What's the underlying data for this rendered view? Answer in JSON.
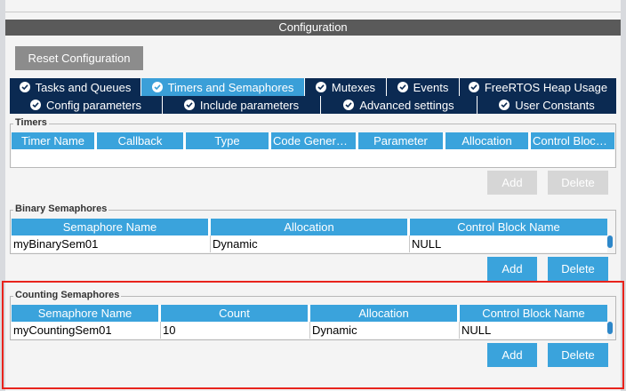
{
  "header": {
    "title": "Configuration"
  },
  "reset_label": "Reset Configuration",
  "tabs_row1": [
    {
      "label": "Tasks and Queues",
      "active": false
    },
    {
      "label": "Timers and Semaphores",
      "active": true
    },
    {
      "label": "Mutexes",
      "active": false
    },
    {
      "label": "Events",
      "active": false
    },
    {
      "label": "FreeRTOS Heap Usage",
      "active": false
    }
  ],
  "tabs_row2": [
    {
      "label": "Config parameters"
    },
    {
      "label": "Include parameters"
    },
    {
      "label": "Advanced settings"
    },
    {
      "label": "User Constants"
    }
  ],
  "timers": {
    "title": "Timers",
    "columns": [
      "Timer Name",
      "Callback",
      "Type",
      "Code Generati...",
      "Parameter",
      "Allocation",
      "Control Block ..."
    ],
    "add_label": "Add",
    "delete_label": "Delete"
  },
  "binary": {
    "title": "Binary Semaphores",
    "columns": [
      "Semaphore Name",
      "Allocation",
      "Control Block Name"
    ],
    "rows": [
      [
        "myBinarySem01",
        "Dynamic",
        "NULL"
      ]
    ],
    "add_label": "Add",
    "delete_label": "Delete"
  },
  "counting": {
    "title": "Counting Semaphores",
    "columns": [
      "Semaphore Name",
      "Count",
      "Allocation",
      "Control Block Name"
    ],
    "rows": [
      [
        "myCountingSem01",
        "10",
        "Dynamic",
        "NULL"
      ]
    ],
    "add_label": "Add",
    "delete_label": "Delete"
  },
  "colors": {
    "tab_bg": "#0b2a52",
    "tab_active": "#3a9fd8",
    "header_blue": "#3aa3dc",
    "highlight": "#e8231c"
  }
}
